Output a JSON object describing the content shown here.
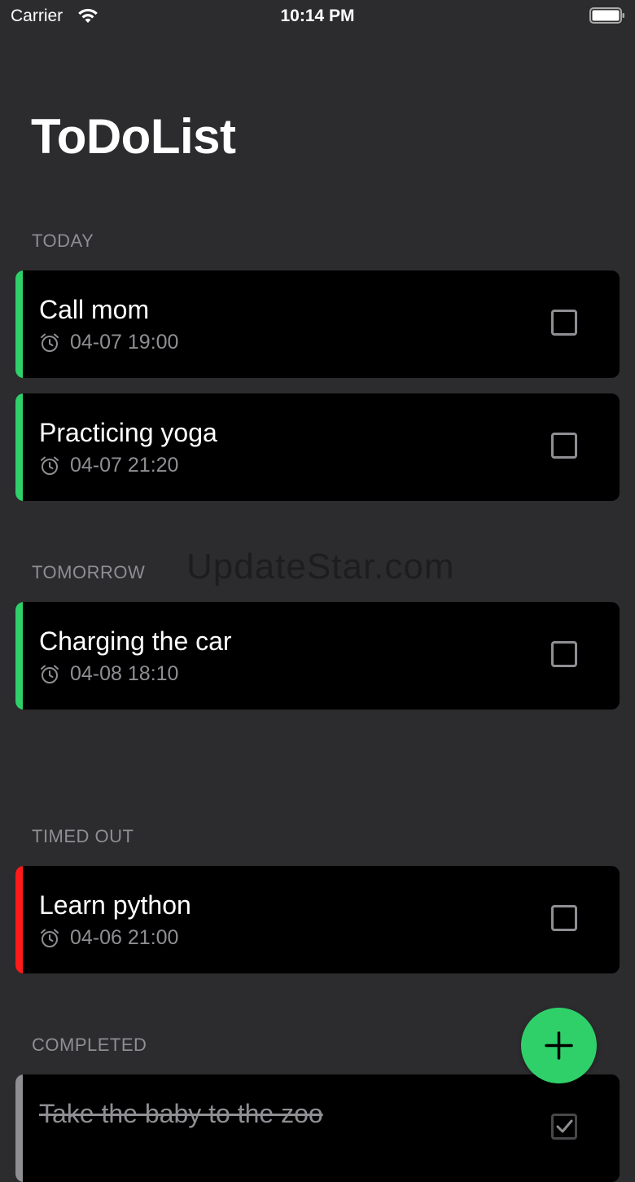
{
  "status_bar": {
    "carrier": "Carrier",
    "time": "10:14 PM"
  },
  "app": {
    "title": "ToDoList",
    "watermark": "UpdateStar.com"
  },
  "colors": {
    "background": "#2c2c2e",
    "card": "#000000",
    "green_stripe": "#2fd06a",
    "red_stripe": "#ff1a1a",
    "gray_stripe": "#8e8e93",
    "secondary_text": "#8e8e93",
    "fab": "#2fd06a"
  },
  "sections": {
    "today": {
      "header": "TODAY",
      "tasks": [
        {
          "title": "Call mom",
          "time": "04-07 19:00",
          "done": false
        },
        {
          "title": "Practicing yoga",
          "time": "04-07 21:20",
          "done": false
        }
      ]
    },
    "tomorrow": {
      "header": "TOMORROW",
      "tasks": [
        {
          "title": "Charging the car",
          "time": "04-08 18:10",
          "done": false
        }
      ]
    },
    "timed_out": {
      "header": "TIMED OUT",
      "tasks": [
        {
          "title": "Learn python",
          "time": "04-06 21:00",
          "done": false
        }
      ]
    },
    "completed": {
      "header": "COMPLETED",
      "tasks": [
        {
          "title": "Take the baby to the zoo",
          "done": true
        }
      ]
    }
  },
  "icons": {
    "alarm": "alarm-clock-icon",
    "checkbox": "checkbox-icon",
    "add": "plus-icon",
    "wifi": "wifi-icon",
    "battery": "battery-icon"
  }
}
